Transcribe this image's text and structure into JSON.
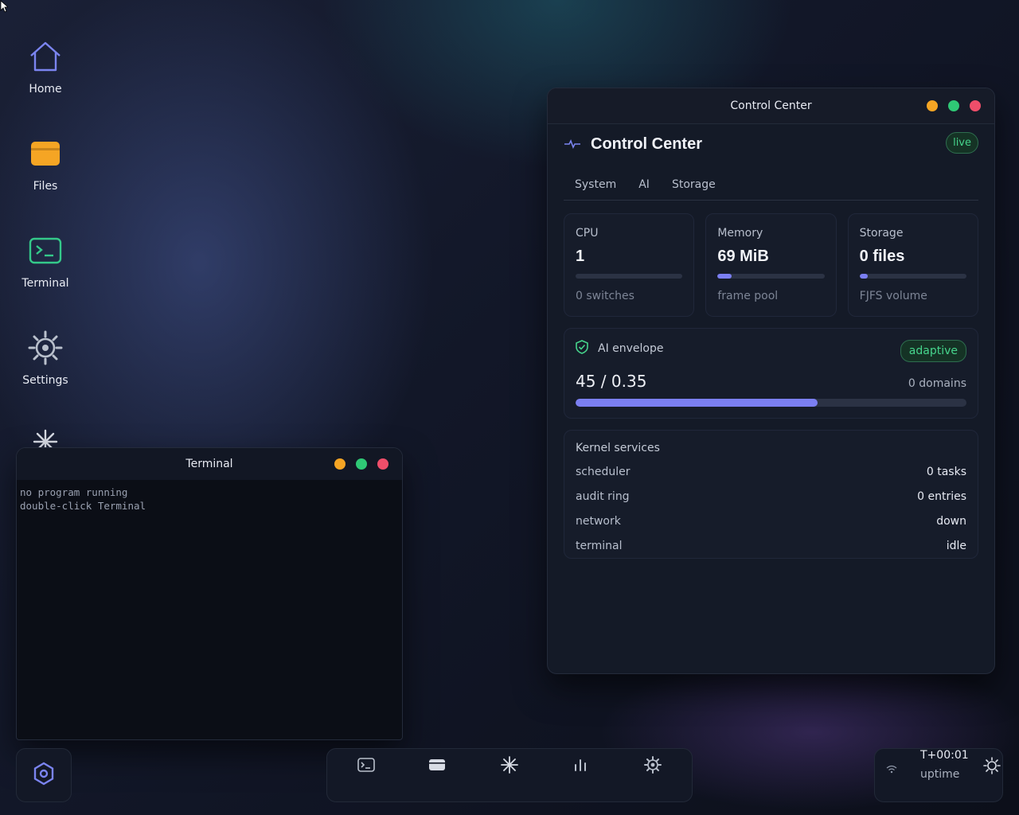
{
  "desktop": {
    "icons": [
      {
        "label": "Home",
        "icon": "home-icon"
      },
      {
        "label": "Files",
        "icon": "folder-icon"
      },
      {
        "label": "Terminal",
        "icon": "terminal-icon"
      },
      {
        "label": "Settings",
        "icon": "gear-icon"
      },
      {
        "label": "",
        "icon": "sparkle-icon"
      }
    ]
  },
  "terminal": {
    "title": "Terminal",
    "lines": [
      "no program running",
      "double-click Terminal"
    ]
  },
  "control_center": {
    "window_title": "Control Center",
    "heading": "Control Center",
    "live_badge": "live",
    "tabs": [
      "System",
      "AI",
      "Storage"
    ],
    "stats": [
      {
        "title": "CPU",
        "value": "1",
        "sub": "0 switches",
        "progress": 0.0
      },
      {
        "title": "Memory",
        "value": "69 MiB",
        "sub": "frame pool",
        "progress": 0.13
      },
      {
        "title": "Storage",
        "value": "0 files",
        "sub": "FJFS volume",
        "progress": 0.08
      }
    ],
    "envelope": {
      "title": "AI envelope",
      "badge": "adaptive",
      "value": "45 / 0.35",
      "domains": "0 domains",
      "progress": 0.62
    },
    "kernel": {
      "title": "Kernel services",
      "rows": [
        {
          "name": "scheduler",
          "value": "0 tasks"
        },
        {
          "name": "audit ring",
          "value": "0 entries"
        },
        {
          "name": "network",
          "value": "down"
        },
        {
          "name": "terminal",
          "value": "idle"
        }
      ]
    }
  },
  "taskbar": {
    "launcher_icon": "hexagon-icon",
    "dock": [
      "terminal-icon",
      "folder-icon",
      "sparkle-icon",
      "bar-chart-icon",
      "gear-icon"
    ],
    "clock": "T+00:01",
    "uptime_label": "uptime",
    "tray_icons": [
      "wifi-icon",
      "brightness-icon"
    ]
  },
  "colors": {
    "accent": "#7b7ff2",
    "success": "#46d48c",
    "minimize": "#f5a524",
    "maximize": "#2fc875",
    "close": "#ef4e6a"
  }
}
